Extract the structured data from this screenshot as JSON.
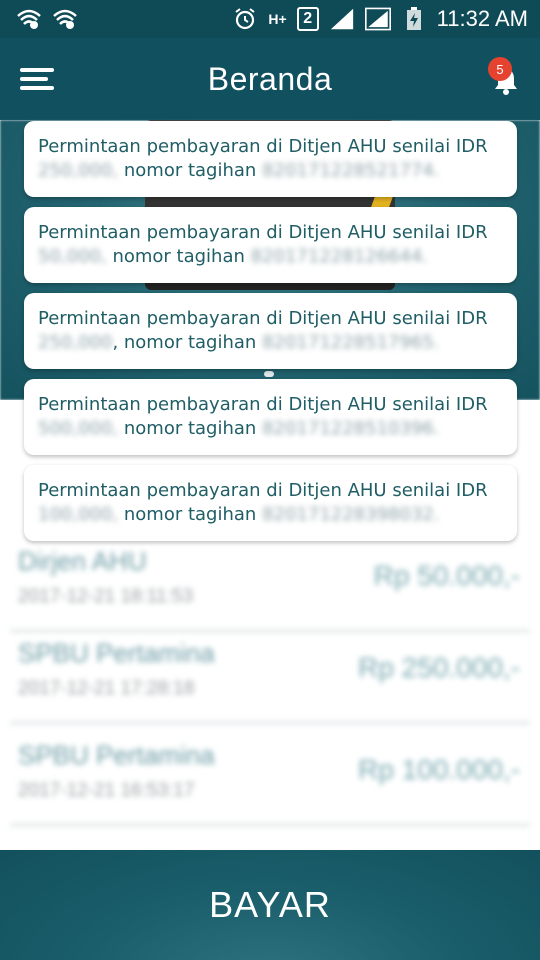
{
  "status_bar": {
    "time": "11:32 AM",
    "network_label": "H+",
    "sim_label": "2",
    "icons": [
      "wifi-question-icon",
      "wifi-question-icon",
      "alarm-icon",
      "data-arrows-icon",
      "signal-icon",
      "signal-icon",
      "battery-charging-icon"
    ]
  },
  "app_bar": {
    "title": "Beranda",
    "notification_count": "5"
  },
  "notifications": [
    {
      "prefix": "Permintaan pembayaran di Ditjen AHU senilai IDR",
      "amount": "250,000,",
      "mid": " nomor tagihan ",
      "bill": "820171228521774."
    },
    {
      "prefix": "Permintaan pembayaran di Ditjen AHU senilai IDR",
      "amount": "50,000,",
      "mid": " nomor tagihan ",
      "bill": "820171228126644."
    },
    {
      "prefix": "Permintaan pembayaran di Ditjen AHU senilai IDR",
      "amount": "250,000",
      "mid": ", nomor tagihan ",
      "bill": "820171228517965."
    },
    {
      "prefix": "Permintaan pembayaran di Ditjen AHU senilai IDR",
      "amount": "500,000,",
      "mid": " nomor tagihan ",
      "bill": "820171228510396."
    },
    {
      "prefix": "Permintaan pembayaran di Ditjen AHU senilai IDR",
      "amount": "100,000,",
      "mid": " nomor tagihan ",
      "bill": "820171228398032."
    }
  ],
  "transactions": [
    {
      "name": "Dirjen AHU",
      "date": "2017-12-21 18:11:53",
      "amount": "Rp 50.000,-"
    },
    {
      "name": "SPBU Pertamina",
      "date": "2017-12-21 17:28:18",
      "amount": "Rp 250.000,-"
    },
    {
      "name": "SPBU Pertamina",
      "date": "2017-12-21 16:53:17",
      "amount": "Rp 100.000,-"
    }
  ],
  "pay_button": {
    "label": "BAYAR"
  },
  "colors": {
    "primary": "#11505e",
    "status_bar": "#0f4a57",
    "badge": "#e5432f",
    "text_teal": "#205e66"
  }
}
